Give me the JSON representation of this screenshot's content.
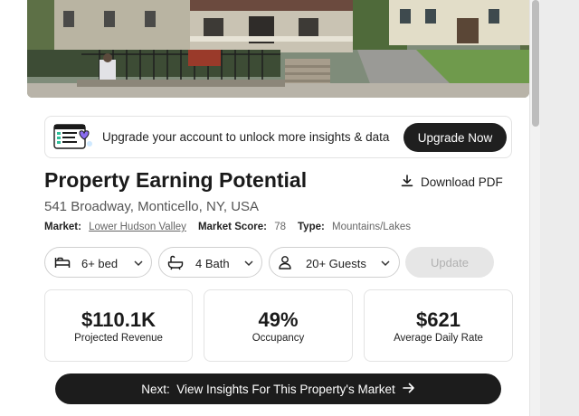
{
  "banner": {
    "text": "Upgrade your account to unlock more insights & data",
    "button_label": "Upgrade Now"
  },
  "header": {
    "title": "Property Earning Potential",
    "download_label": "Download PDF",
    "address": "541 Broadway, Monticello, NY, USA"
  },
  "meta": {
    "market_label": "Market:",
    "market_value": "Lower Hudson Valley",
    "score_label": "Market Score:",
    "score_value": "78",
    "type_label": "Type:",
    "type_value": "Mountains/Lakes"
  },
  "filters": {
    "beds": "6+ bed",
    "baths": "4 Bath",
    "guests": "20+ Guests",
    "update_label": "Update"
  },
  "stats": [
    {
      "value": "$110.1K",
      "label": "Projected Revenue"
    },
    {
      "value": "49%",
      "label": "Occupancy"
    },
    {
      "value": "$621",
      "label": "Average Daily Rate"
    }
  ],
  "next_button": "Next:  View Insights For This Property's Market",
  "icons": {
    "download": "download-icon",
    "bed": "bed-icon",
    "bath": "bath-icon",
    "guests": "person-icon",
    "chevron": "chevron-down-icon",
    "arrow": "arrow-right-icon"
  },
  "colors": {
    "dark_button": "#1f1f1f",
    "disabled_button": "#e6e6e6",
    "accent_illustration": "#8a6cf0"
  }
}
